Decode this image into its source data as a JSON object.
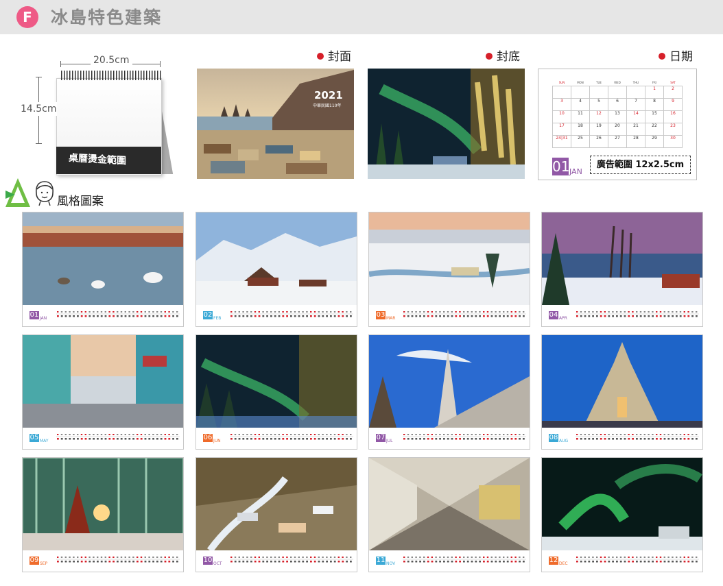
{
  "header": {
    "badge": "F",
    "title": "冰島特色建築"
  },
  "calendar_spec": {
    "width": "20.5cm",
    "height": "14.5cm",
    "base_label": "桌曆燙金範圍"
  },
  "section_label": "風格圖案",
  "labels": {
    "cover": "封面",
    "back": "封底",
    "date": "日期"
  },
  "cover": {
    "year": "2021",
    "subtitle": "中華民國110年"
  },
  "date_page": {
    "weekdays": [
      "SUN",
      "MON",
      "TUE",
      "WED",
      "THU",
      "FRI",
      "SAT"
    ],
    "weeks": [
      [
        "",
        "",
        "",
        "",
        "",
        "1",
        "2"
      ],
      [
        "3",
        "4",
        "5",
        "6",
        "7",
        "8",
        "9"
      ],
      [
        "10",
        "11",
        "12",
        "13",
        "14",
        "15",
        "16"
      ],
      [
        "17",
        "18",
        "19",
        "20",
        "21",
        "22",
        "23"
      ],
      [
        "24|31",
        "25",
        "26",
        "27",
        "28",
        "29",
        "30"
      ]
    ],
    "month_num": "01",
    "month_name": "JAN",
    "ad_area": "廣告範圍 12x2.5cm"
  },
  "colors": {
    "badge": "#ee5a86",
    "accent_red": "#d6202a",
    "jan_purple": "#9158a6",
    "header_bg": "#e6e6e6"
  },
  "months": [
    {
      "num": "01",
      "name": "JAN",
      "color": "#9158a6",
      "scene": "swans-lake"
    },
    {
      "num": "02",
      "name": "FEB",
      "color": "#3ba9d6",
      "scene": "snow-mountain-house"
    },
    {
      "num": "03",
      "name": "MAR",
      "color": "#ef6b2b",
      "scene": "snow-plain-village"
    },
    {
      "num": "04",
      "name": "APR",
      "color": "#9158a6",
      "scene": "sunset-trees"
    },
    {
      "num": "05",
      "name": "MAY",
      "color": "#3ba9d6",
      "scene": "colorful-street"
    },
    {
      "num": "06",
      "name": "JUN",
      "color": "#ef6b2b",
      "scene": "aurora-forest"
    },
    {
      "num": "07",
      "name": "JUL",
      "color": "#9158a6",
      "scene": "church-side"
    },
    {
      "num": "08",
      "name": "AUG",
      "color": "#3ba9d6",
      "scene": "church-front"
    },
    {
      "num": "09",
      "name": "SEP",
      "color": "#ef6b2b",
      "scene": "concert-hall-tree"
    },
    {
      "num": "10",
      "name": "OCT",
      "color": "#9158a6",
      "scene": "town-valley"
    },
    {
      "num": "11",
      "name": "NOV",
      "color": "#3ba9d6",
      "scene": "honeycomb-hall"
    },
    {
      "num": "12",
      "name": "DEC",
      "color": "#ef6b2b",
      "scene": "aurora-house"
    }
  ]
}
